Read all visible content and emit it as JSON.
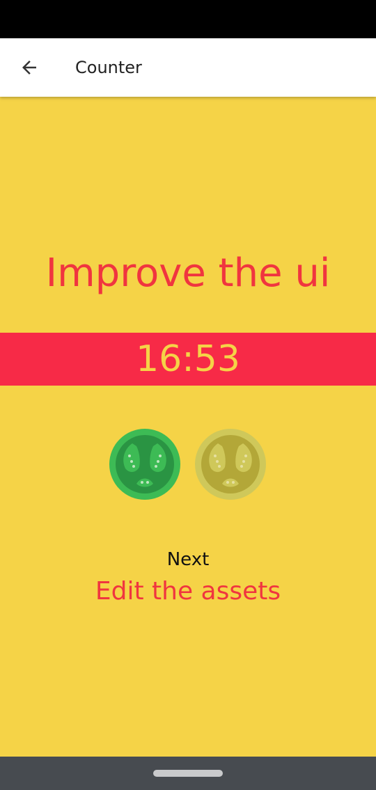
{
  "app_bar": {
    "title": "Counter",
    "back_icon": "arrow-back-icon"
  },
  "main": {
    "current_task": "Improve the ui",
    "timer": "16:53",
    "sessions": [
      {
        "icon": "tomato-icon",
        "state": "completed",
        "color": "#3dbb55"
      },
      {
        "icon": "tomato-icon",
        "state": "pending",
        "color": "#cfc85a"
      }
    ],
    "next_label": "Next",
    "next_task": "Edit the assets"
  },
  "colors": {
    "background": "#f5d347",
    "accent_red": "#f0353f",
    "timer_band": "#f72a47",
    "app_bar": "#ffffff",
    "nav_bar": "#474b50"
  }
}
